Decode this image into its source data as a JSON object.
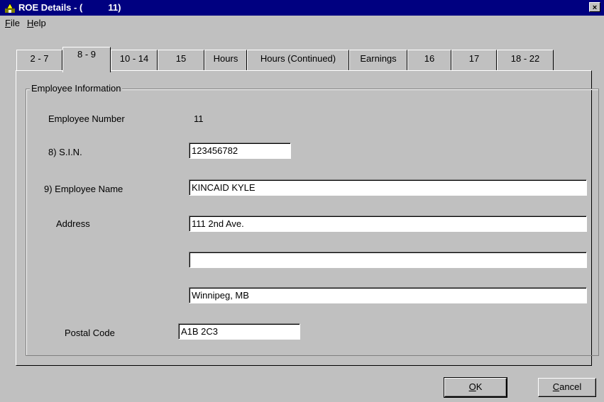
{
  "window": {
    "title": "ROE Details - (          11)",
    "close_glyph": "×",
    "icon": "app-icon"
  },
  "menu": [
    {
      "label": "File",
      "mnemonic": "F",
      "rest": "ile"
    },
    {
      "label": "Help",
      "mnemonic": "H",
      "rest": "elp"
    }
  ],
  "tabs": [
    {
      "label": "2 - 7",
      "active": false
    },
    {
      "label": "8 - 9",
      "active": true
    },
    {
      "label": "10 - 14",
      "active": false
    },
    {
      "label": "15",
      "active": false
    },
    {
      "label": "Hours",
      "active": false
    },
    {
      "label": "Hours (Continued)",
      "active": false
    },
    {
      "label": "Earnings",
      "active": false
    },
    {
      "label": "16",
      "active": false
    },
    {
      "label": "17",
      "active": false
    },
    {
      "label": "18 - 22",
      "active": false
    }
  ],
  "group": {
    "title": "Employee Information"
  },
  "form": {
    "employee_number_label": "Employee Number",
    "employee_number_value": "11",
    "sin_label": "8) S.I.N.",
    "sin_value": "123456782",
    "name_label": "9) Employee Name",
    "name_value": "KINCAID KYLE",
    "address_label": "Address",
    "address_line1": "111 2nd Ave.",
    "address_line2": "",
    "address_line3": "Winnipeg, MB",
    "postal_label": "Postal Code",
    "postal_value": "A1B 2C3"
  },
  "buttons": {
    "ok": {
      "mnemonic": "O",
      "rest": "K"
    },
    "cancel": {
      "mnemonic": "C",
      "rest": "ancel"
    }
  }
}
